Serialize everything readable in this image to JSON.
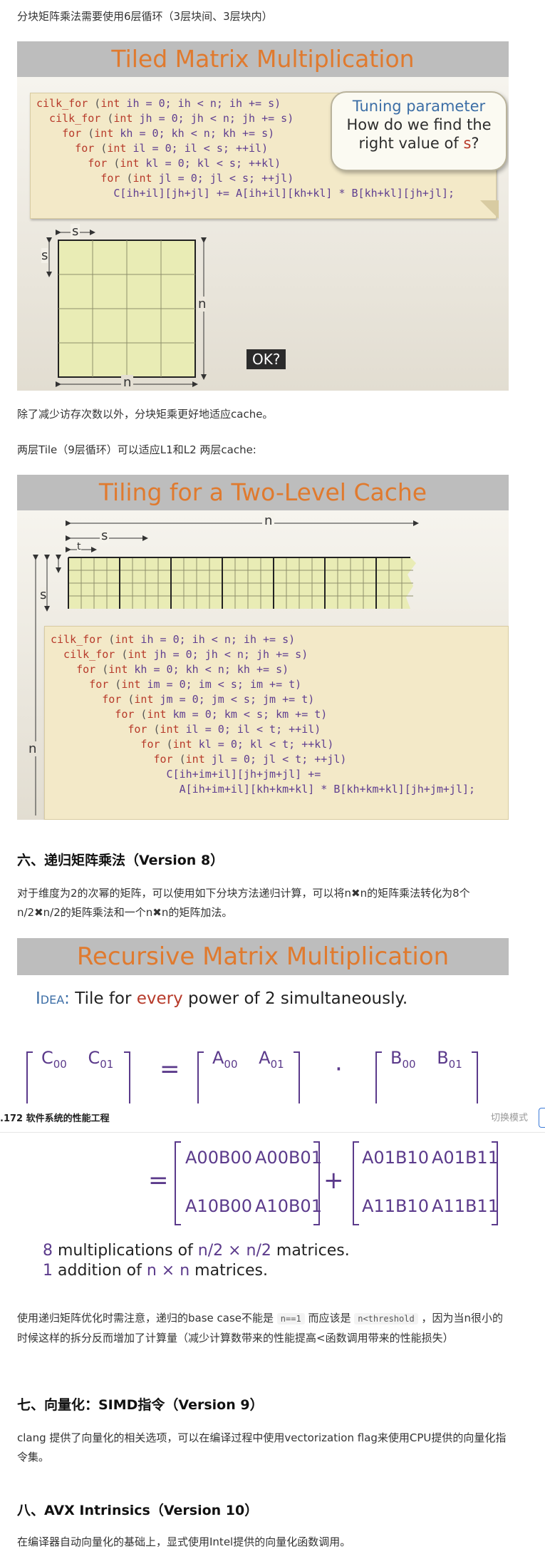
{
  "intro_text": "分块矩阵乘法需要使用6层循环（3层块间、3层块内）",
  "slide1": {
    "title": "Tiled Matrix Multiplication",
    "code": [
      [
        "cilk_for",
        " (",
        "int",
        " ih = 0; ih < n; ih += s)"
      ],
      [
        "  cilk_for",
        " (",
        "int",
        " jh = 0; jh < n; jh += s)"
      ],
      [
        "    for",
        " (",
        "int",
        " kh = 0; kh < n; kh += s)"
      ],
      [
        "      for",
        " (",
        "int",
        " il = 0; il < s; ++il)"
      ],
      [
        "        for",
        " (",
        "int",
        " kl = 0; kl < s; ++kl)"
      ],
      [
        "          for",
        " (",
        "int",
        " jl = 0; jl < s; ++jl)"
      ],
      [
        "",
        "",
        "",
        "            C[ih+il][jh+jl] += A[ih+il][kh+kl] * B[kh+kl][jh+jl];"
      ]
    ],
    "bubble_line1": "Tuning parameter",
    "bubble_line2": "How do we find the",
    "bubble_line3a": "right value of ",
    "bubble_line3b": "s",
    "bubble_line3c": "?",
    "label_s_top": "s",
    "label_s_left": "s",
    "label_n_right": "n",
    "label_n_bottom": "n",
    "ok": "OK?"
  },
  "text_cache": "除了减少访存次数以外，分块矩乘更好地适应cache。",
  "text_twolevel": "两层Tile（9层循环）可以适应L1和L2 两层cache:",
  "slide2": {
    "title": "Tiling for a Two-Level Cache",
    "label_n_top": "n",
    "label_s_top": "s",
    "label_t_top": "t",
    "label_s_left": "s",
    "label_n_left": "n",
    "code": [
      [
        "cilk_for",
        " (",
        "int",
        " ih = 0; ih < n; ih += s)"
      ],
      [
        "  cilk_for",
        " (",
        "int",
        " jh = 0; jh < n; jh += s)"
      ],
      [
        "    for",
        " (",
        "int",
        " kh = 0; kh < n; kh += s)"
      ],
      [
        "      for",
        " (",
        "int",
        " im = 0; im < s; im += t)"
      ],
      [
        "        for",
        " (",
        "int",
        " jm = 0; jm < s; jm += t)"
      ],
      [
        "          for",
        " (",
        "int",
        " km = 0; km < s; km += t)"
      ],
      [
        "            for",
        " (",
        "int",
        " il = 0; il < t; ++il)"
      ],
      [
        "              for",
        " (",
        "int",
        " kl = 0; kl < t; ++kl)"
      ],
      [
        "                for",
        " (",
        "int",
        " jl = 0; jl < t; ++jl)"
      ],
      [
        "",
        "",
        "",
        "                  C[ih+im+il][jh+jm+jl] +="
      ],
      [
        "",
        "",
        "",
        "                    A[ih+im+il][kh+km+kl] * B[kh+km+kl][jh+jm+jl];"
      ]
    ]
  },
  "section6_heading": "六、递归矩阵乘法（Version 8）",
  "section6_text": "对于维度为2的次幂的矩阵，可以使用如下分块方法递归计算，可以将n✖n的矩阵乘法转化为8个n/2✖n/2的矩阵乘法和一个n✖n的矩阵加法。",
  "slide3": {
    "title": "Recursive Matrix Multiplication",
    "idea_label": "Idea:",
    "idea_pre": " Tile for ",
    "idea_every": "every",
    "idea_post": " power of 2 simultaneously.",
    "C00": "C00",
    "C01": "C01",
    "A00": "A00",
    "A01": "A01",
    "B00": "B00",
    "B01": "B01",
    "eq": "=",
    "dot": "·"
  },
  "tabbar": {
    "title": ".172 软件系统的性能工程",
    "mode_button": "切换模式"
  },
  "slide3b": {
    "r1c1": "A00B00",
    "r1c2": "A00B01",
    "r2c1": "A10B00",
    "r2c2": "A10B01",
    "s1c1": "A01B10",
    "s1c2": "A01B11",
    "s2c1": "A11B10",
    "s2c2": "A11B11",
    "eq": "=",
    "plus": "+",
    "line1_n": "8",
    "line1_rest": " multiplications of ",
    "line1_dim": "n/2 × n/2",
    "line1_end": " matrices.",
    "line2_n": "1",
    "line2_rest": " addition of ",
    "line2_dim": "n × n",
    "line2_end": " matrices."
  },
  "text_base_case_pre": "使用递归矩阵优化时需注意，递归的base case不能是 ",
  "text_base_case_code1": "n==1",
  "text_base_case_mid": " 而应该是 ",
  "text_base_case_code2": "n<threshold",
  "text_base_case_post": " ，因为当n很小的时候这样的拆分反而增加了计算量（减少计算数带来的性能提高<函数调用带来的性能损失）",
  "section7_heading": "七、向量化：SIMD指令（Version 9）",
  "section7_text": "clang 提供了向量化的相关选项，可以在编译过程中使用vectorization flag来使用CPU提供的向量化指令集。",
  "section8_heading": "八、AVX Intrinsics（Version 10）",
  "section8_text": "在编译器自动向量化的基础上，显式使用Intel提供的向量化函数调用。"
}
